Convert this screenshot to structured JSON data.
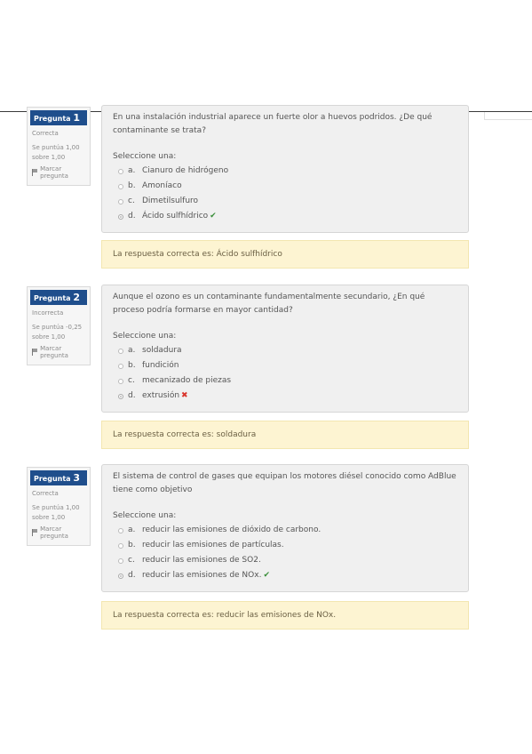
{
  "questions": [
    {
      "label": "Pregunta",
      "number": "1",
      "status": "Correcta",
      "score_line": "Se puntúa 1,00",
      "max_line": "sobre 1,00",
      "flag_label": "Marcar pregunta",
      "text": "En una instalación industrial aparece un fuerte olor a huevos podridos. ¿De qué contaminante se trata?",
      "select_label": "Seleccione una:",
      "options": [
        {
          "letter": "a.",
          "text": "Cianuro de hidrógeno"
        },
        {
          "letter": "b.",
          "text": "Amoníaco"
        },
        {
          "letter": "c.",
          "text": "Dimetilsulfuro"
        },
        {
          "letter": "d.",
          "text": "Ácido sulfhídrico"
        }
      ],
      "selected": 3,
      "result": "correct",
      "feedback": "La respuesta correcta es: Ácido sulfhídrico"
    },
    {
      "label": "Pregunta",
      "number": "2",
      "status": "Incorrecta",
      "score_line": "Se puntúa -0,25",
      "max_line": "sobre 1,00",
      "flag_label": "Marcar pregunta",
      "text": "Aunque el ozono es un contaminante fundamentalmente secundario, ¿En qué proceso podría formarse en mayor cantidad?",
      "select_label": "Seleccione una:",
      "options": [
        {
          "letter": "a.",
          "text": "soldadura"
        },
        {
          "letter": "b.",
          "text": "fundición"
        },
        {
          "letter": "c.",
          "text": "mecanizado de piezas"
        },
        {
          "letter": "d.",
          "text": "extrusión"
        }
      ],
      "selected": 3,
      "result": "incorrect",
      "feedback": "La respuesta correcta es: soldadura"
    },
    {
      "label": "Pregunta",
      "number": "3",
      "status": "Correcta",
      "score_line": "Se puntúa 1,00",
      "max_line": "sobre 1,00",
      "flag_label": "Marcar pregunta",
      "text": "El sistema de control de gases que equipan los motores diésel conocido como AdBlue tiene como objetivo",
      "select_label": "Seleccione una:",
      "options": [
        {
          "letter": "a.",
          "text": "reducir las emisiones de dióxido de carbono."
        },
        {
          "letter": "b.",
          "text": "reducir las emisiones de partículas."
        },
        {
          "letter": "c.",
          "text": "reducir las emisiones de SO2."
        },
        {
          "letter": "d.",
          "text": "reducir las emisiones de NOx."
        }
      ],
      "selected": 3,
      "result": "correct",
      "feedback": "La respuesta correcta es: reducir las emisiones de NOx."
    }
  ],
  "icons": {
    "correct": "check-icon",
    "incorrect": "cross-icon",
    "flag": "flag-icon"
  },
  "colors": {
    "question_header": "#1f4e8c",
    "feedback_bg": "#fdf4d2",
    "correct": "#3a8f3a",
    "incorrect": "#d9342b"
  }
}
